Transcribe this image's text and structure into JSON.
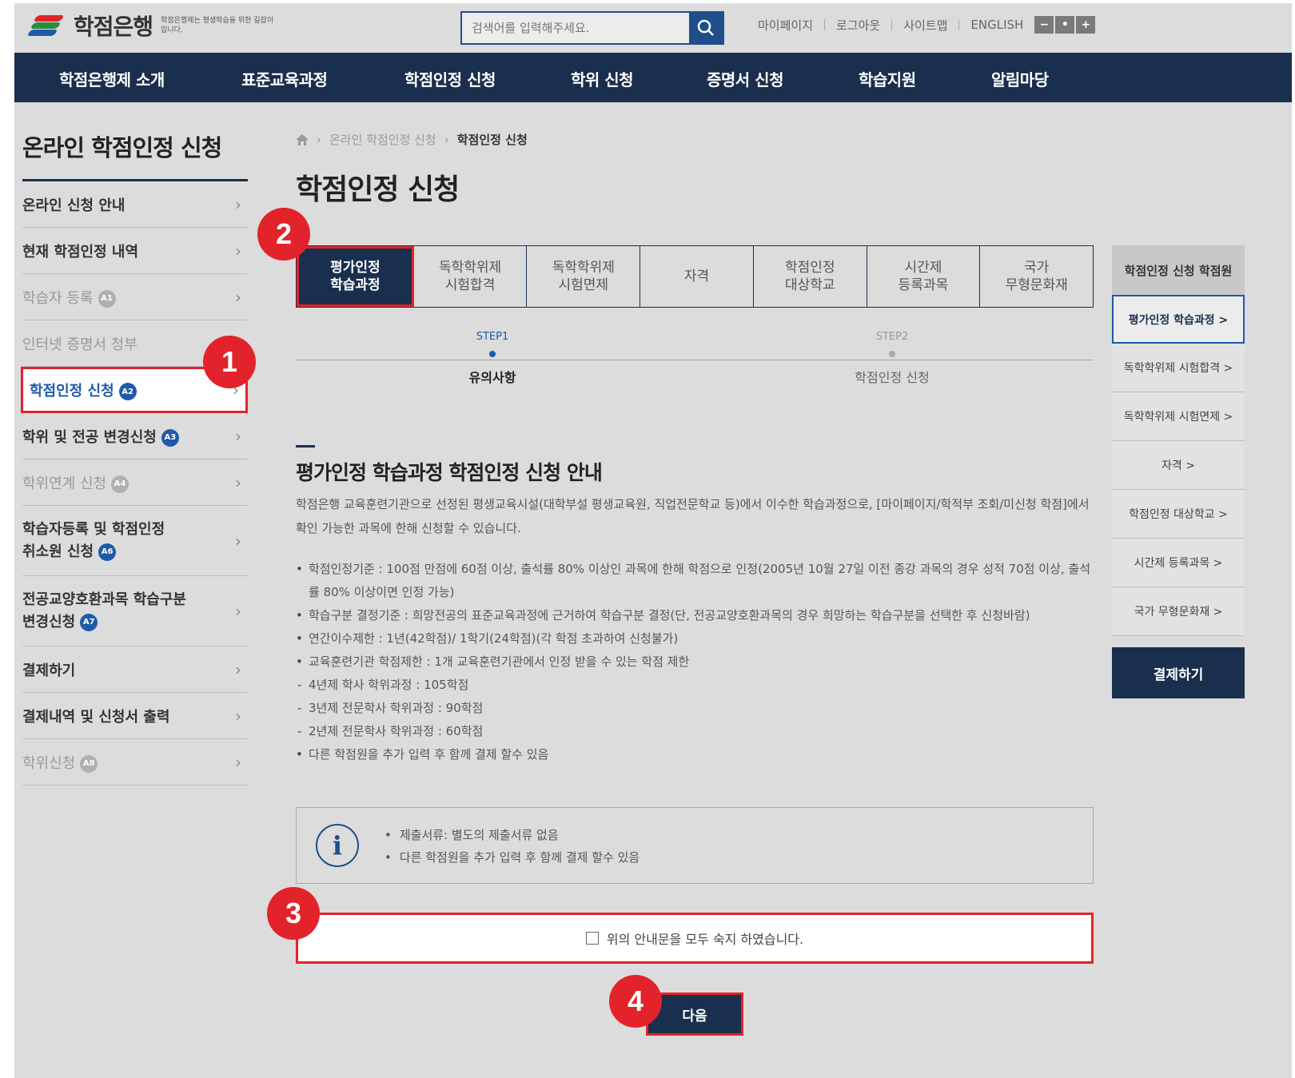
{
  "header": {
    "logo_title": "학점은행",
    "logo_sub": "학점은행제는 평생학습을 위한 길잡이 입니다.",
    "search_placeholder": "검색어를 입력해주세요.",
    "util_links": [
      "마이페이지",
      "로그아웃",
      "사이트맵",
      "ENGLISH"
    ],
    "font_controls": [
      "−",
      "•",
      "+"
    ]
  },
  "gnb": [
    "학점은행제 소개",
    "표준교육과정",
    "학점인정 신청",
    "학위 신청",
    "증명서 신청",
    "학습지원",
    "알림마당"
  ],
  "sidebar": {
    "title": "온라인 학점인정 신청",
    "items": [
      {
        "label": "온라인 신청 안내"
      },
      {
        "label": "현재 학점인정 내역"
      },
      {
        "label": "학습자 등록",
        "badge": "A1"
      },
      {
        "label": "인터넷 증명서 청부"
      },
      {
        "label": "학점인정 신청",
        "badge": "A2"
      },
      {
        "label": "학위 및 전공 변경신청",
        "badge": "A3"
      },
      {
        "label": "학위연계 신청",
        "badge": "A4"
      },
      {
        "label": "학습자등록 및 학점인정",
        "label2": "취소원 신청",
        "badge": "A6"
      },
      {
        "label": "전공교양호환과목 학습구분",
        "label2": "변경신청",
        "badge": "A7"
      },
      {
        "label": "결제하기"
      },
      {
        "label": "결제내역 및 신청서 출력"
      },
      {
        "label": "학위신청",
        "badge": "A8"
      }
    ]
  },
  "breadcrumb": {
    "level1": "온라인 학점인정 신청",
    "current": "학점인정 신청"
  },
  "page_title": "학점인정 신청",
  "tabs": [
    {
      "l1": "평가인정",
      "l2": "학습과정"
    },
    {
      "l1": "독학학위제",
      "l2": "시험합격"
    },
    {
      "l1": "독학학위제",
      "l2": "시험면제"
    },
    {
      "l1": "자격",
      "l2": ""
    },
    {
      "l1": "학점인정",
      "l2": "대상학교"
    },
    {
      "l1": "시간제",
      "l2": "등록과목"
    },
    {
      "l1": "국가",
      "l2": "무형문화재"
    }
  ],
  "steps": [
    {
      "label": "STEP1",
      "name": "유의사항"
    },
    {
      "label": "STEP2",
      "name": "학점인정 신청"
    }
  ],
  "section": {
    "title": "평가인정 학습과정 학점인정 신청 안내",
    "desc": "학점은행 교육훈련기관으로 선정된 평생교육시설(대학부설 평생교육원, 직업전문학교 등)에서 이수한 학습과정으로, [마이페이지/학적부 조회/미신청 학점]에서 확인 가능한 과목에 한해 신청할 수 있습니다.",
    "bullets": [
      "학점인정기준 : 100점 만점에 60점 이상, 출석률 80% 이상인 과목에 한해 학점으로 인정(2005년 10월 27일 이전 종강 과목의 경우 성적 70점 이상, 출석률 80% 이상이면 인정 가능)",
      "학습구분 결정기준 : 희망전공의 표준교육과정에 근거하여 학습구분 결정(단, 전공교양호환과목의 경우 희망하는 학습구분을 선택한 후 신청바람)",
      "연간이수제한 : 1년(42학점)/ 1학기(24학점)(각 학점 초과하여 신청불가)",
      "교육훈련기관 학점제한 : 1개 교육훈련기관에서 인정 받을 수 있는 학점 제한"
    ],
    "sub_bullets": [
      "4년제 학사 학위과정 : 105학점",
      "3년제 전문학사 학위과정 : 90학점",
      "2년제 전문학사 학위과정 : 60학점"
    ],
    "last_bullet": "다른 학점원을 추가 입력 후 함께 결제 할수 있음"
  },
  "info_box": {
    "icon": "info-icon",
    "lines": [
      "제출서류: 별도의 제출서류 없음",
      "다른 학점원을 추가 입력 후 함께 결제 할수 있음"
    ]
  },
  "agree_label": "위의 안내문을 모두 숙지 하였습니다.",
  "next_label": "다음",
  "right_panel": {
    "title": "학점인정 신청 학점원",
    "items": [
      "평가인정 학습과정 >",
      "독학학위제 시험합격 >",
      "독학학위제 시험면제 >",
      "자격 >",
      "학점인정 대상학교 >",
      "시간제 등록과목 >",
      "국가 무형문화재 >"
    ],
    "pay_label": "결제하기"
  },
  "markers": [
    "1",
    "2",
    "3",
    "4"
  ],
  "colors": {
    "navy": "#1a2f4e",
    "accent_blue": "#1f5aa8",
    "highlight_red": "#e3232b"
  }
}
